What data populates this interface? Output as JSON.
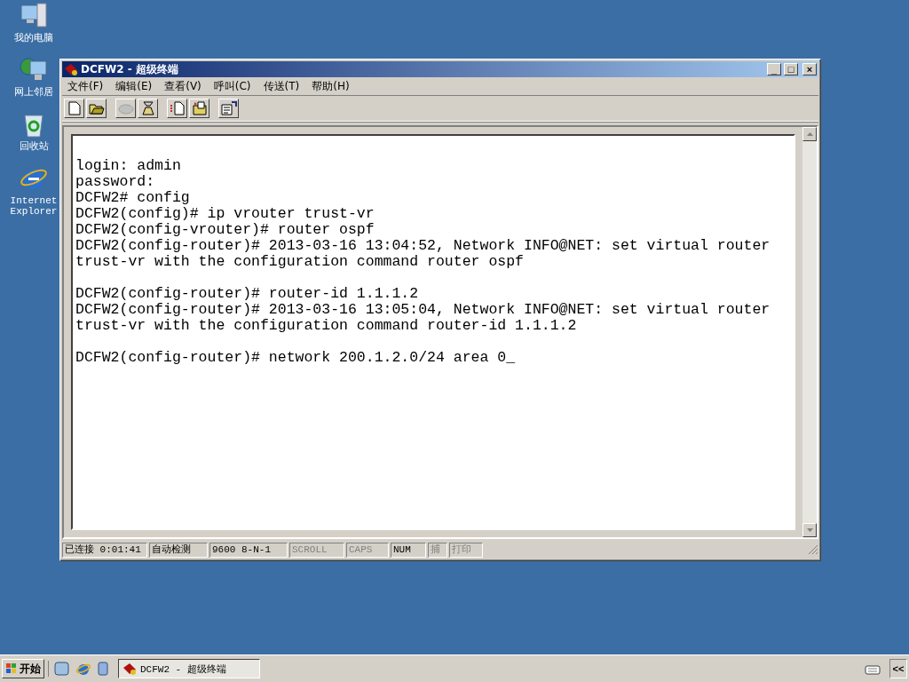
{
  "desktop_icons": [
    {
      "kind": "computer",
      "label": "我的电脑"
    },
    {
      "kind": "network",
      "label": "网上邻居"
    },
    {
      "kind": "recycle",
      "label": "回收站"
    },
    {
      "kind": "ie",
      "label": "Internet Explorer"
    }
  ],
  "window": {
    "title": "DCFW2 - 超级终端",
    "controls": [
      "_",
      "□",
      "×"
    ]
  },
  "menu": [
    "文件(F)",
    "编辑(E)",
    "查看(V)",
    "呼叫(C)",
    "传送(T)",
    "帮助(H)"
  ],
  "toolbar": [
    [
      {
        "kind": "new",
        "disabled": false
      },
      {
        "kind": "open",
        "disabled": false
      }
    ],
    [
      {
        "kind": "call",
        "disabled": true
      },
      {
        "kind": "hangup",
        "disabled": false
      }
    ],
    [
      {
        "kind": "send",
        "disabled": false
      },
      {
        "kind": "receive",
        "disabled": false
      }
    ],
    [
      {
        "kind": "properties",
        "disabled": false
      }
    ]
  ],
  "terminal": {
    "blocks": [
      [
        "login: admin",
        "password:",
        "DCFW2# config",
        "DCFW2(config)# ip vrouter trust-vr",
        "DCFW2(config-vrouter)# router ospf",
        "DCFW2(config-router)# 2013-03-16 13:04:52, Network INFO@NET: set virtual router",
        "trust-vr with the configuration command router ospf"
      ],
      [
        "DCFW2(config-router)# router-id 1.1.1.2",
        "DCFW2(config-router)# 2013-03-16 13:05:04, Network INFO@NET: set virtual router",
        "trust-vr with the configuration command router-id 1.1.1.2"
      ],
      [
        "DCFW2(config-router)# network 200.1.2.0/24 area 0_"
      ]
    ]
  },
  "status_bar": [
    {
      "text": "已连接 0:01:41",
      "active": true
    },
    {
      "text": "自动检测",
      "active": true
    },
    {
      "text": "9600 8-N-1",
      "active": true
    },
    {
      "text": "SCROLL",
      "active": false
    },
    {
      "text": "CAPS",
      "active": false
    },
    {
      "text": "NUM",
      "active": true
    },
    {
      "text": "捕",
      "active": false
    },
    {
      "text": "打印",
      "active": false
    }
  ],
  "taskbar": {
    "start": "开始",
    "quick_launch": [
      {
        "kind": "desktop"
      },
      {
        "kind": "ie"
      },
      {
        "kind": "outlook"
      }
    ],
    "tasks": [
      {
        "label": "DCFW2 - 超级终端",
        "selected": true
      }
    ],
    "tray_button": "<<"
  }
}
